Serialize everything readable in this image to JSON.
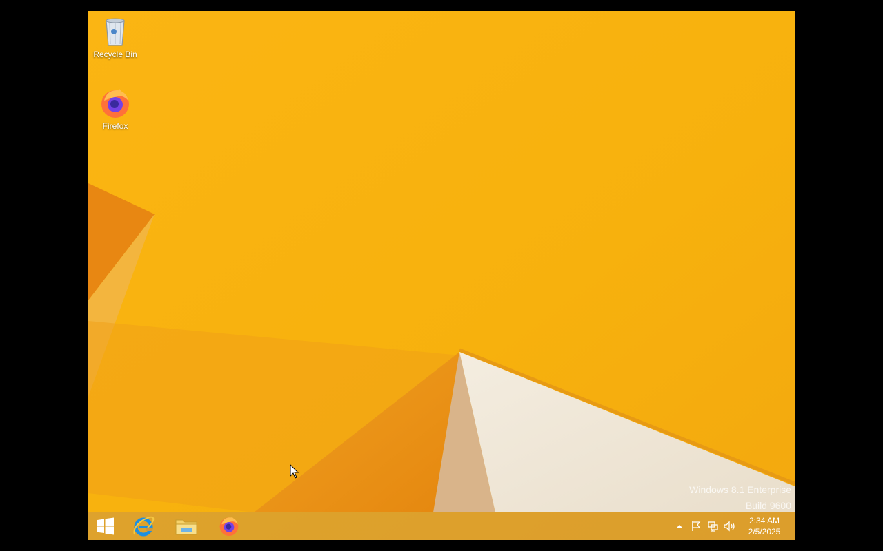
{
  "desktop": {
    "icons": [
      {
        "label": "Recycle Bin",
        "icon": "recycle-bin-icon"
      },
      {
        "label": "Firefox",
        "icon": "firefox-icon"
      }
    ],
    "watermark": {
      "line1": "Windows 8.1 Enterprise",
      "line2": "Build 9600"
    },
    "colors": {
      "wallpaper": "#f6ad12",
      "accent_orange": "#e8890f",
      "accent_cream": "#efe6d6"
    }
  },
  "taskbar": {
    "buttons": [
      {
        "name": "start",
        "icon": "windows-logo-icon"
      },
      {
        "name": "internet-explorer",
        "icon": "internet-explorer-icon"
      },
      {
        "name": "file-explorer",
        "icon": "folder-icon"
      },
      {
        "name": "firefox",
        "icon": "firefox-icon"
      }
    ],
    "tray": {
      "icons": [
        "chevron-up-icon",
        "flag-icon",
        "network-icon",
        "volume-icon"
      ],
      "time": "2:34 AM",
      "date": "2/5/2025"
    }
  }
}
